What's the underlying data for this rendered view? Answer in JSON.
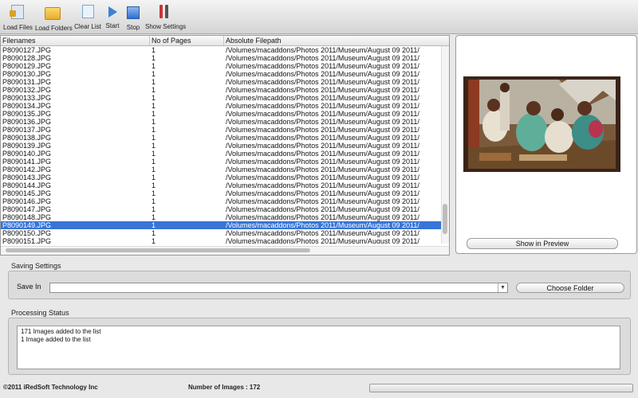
{
  "toolbar": {
    "load_files": "Load Files",
    "load_folders": "Load Folders",
    "clear_list": "Clear List",
    "start": "Start",
    "stop": "Stop",
    "show_settings": "Show Settings"
  },
  "table": {
    "columns": [
      "Filenames",
      "No of Pages",
      "Absolute Filepath"
    ],
    "selected_index": 22,
    "rows": [
      [
        "P8090127.JPG",
        "1",
        "/Volumes/macaddons/Photos 2011/Museum/August 09 2011/"
      ],
      [
        "P8090128.JPG",
        "1",
        "/Volumes/macaddons/Photos 2011/Museum/August 09 2011/"
      ],
      [
        "P8090129.JPG",
        "1",
        "/Volumes/macaddons/Photos 2011/Museum/August 09 2011/"
      ],
      [
        "P8090130.JPG",
        "1",
        "/Volumes/macaddons/Photos 2011/Museum/August 09 2011/"
      ],
      [
        "P8090131.JPG",
        "1",
        "/Volumes/macaddons/Photos 2011/Museum/August 09 2011/"
      ],
      [
        "P8090132.JPG",
        "1",
        "/Volumes/macaddons/Photos 2011/Museum/August 09 2011/"
      ],
      [
        "P8090133.JPG",
        "1",
        "/Volumes/macaddons/Photos 2011/Museum/August 09 2011/"
      ],
      [
        "P8090134.JPG",
        "1",
        "/Volumes/macaddons/Photos 2011/Museum/August 09 2011/"
      ],
      [
        "P8090135.JPG",
        "1",
        "/Volumes/macaddons/Photos 2011/Museum/August 09 2011/"
      ],
      [
        "P8090136.JPG",
        "1",
        "/Volumes/macaddons/Photos 2011/Museum/August 09 2011/"
      ],
      [
        "P8090137.JPG",
        "1",
        "/Volumes/macaddons/Photos 2011/Museum/August 09 2011/"
      ],
      [
        "P8090138.JPG",
        "1",
        "/Volumes/macaddons/Photos 2011/Museum/August 09 2011/"
      ],
      [
        "P8090139.JPG",
        "1",
        "/Volumes/macaddons/Photos 2011/Museum/August 09 2011/"
      ],
      [
        "P8090140.JPG",
        "1",
        "/Volumes/macaddons/Photos 2011/Museum/August 09 2011/"
      ],
      [
        "P8090141.JPG",
        "1",
        "/Volumes/macaddons/Photos 2011/Museum/August 09 2011/"
      ],
      [
        "P8090142.JPG",
        "1",
        "/Volumes/macaddons/Photos 2011/Museum/August 09 2011/"
      ],
      [
        "P8090143.JPG",
        "1",
        "/Volumes/macaddons/Photos 2011/Museum/August 09 2011/"
      ],
      [
        "P8090144.JPG",
        "1",
        "/Volumes/macaddons/Photos 2011/Museum/August 09 2011/"
      ],
      [
        "P8090145.JPG",
        "1",
        "/Volumes/macaddons/Photos 2011/Museum/August 09 2011/"
      ],
      [
        "P8090146.JPG",
        "1",
        "/Volumes/macaddons/Photos 2011/Museum/August 09 2011/"
      ],
      [
        "P8090147.JPG",
        "1",
        "/Volumes/macaddons/Photos 2011/Museum/August 09 2011/"
      ],
      [
        "P8090148.JPG",
        "1",
        "/Volumes/macaddons/Photos 2011/Museum/August 09 2011/"
      ],
      [
        "P8090149.JPG",
        "1",
        "/Volumes/macaddons/Photos 2011/Museum/August 09 2011/"
      ],
      [
        "P8090150.JPG",
        "1",
        "/Volumes/macaddons/Photos 2011/Museum/August 09 2011/"
      ],
      [
        "P8090151.JPG",
        "1",
        "/Volumes/macaddons/Photos 2011/Museum/August 09 2011/"
      ]
    ]
  },
  "preview": {
    "button_label": "Show in Preview"
  },
  "saving": {
    "group_title": "Saving Settings",
    "save_in_label": "Save In",
    "save_in_value": "",
    "choose_folder": "Choose Folder"
  },
  "processing": {
    "group_title": "Processing Status",
    "lines": [
      "171 Images added to the list",
      "1 Image added to the list"
    ]
  },
  "footer": {
    "copyright": "©2011 iRedSoft Technology Inc",
    "image_count": "Number of Images : 172",
    "progress": 0
  },
  "colors": {
    "selection": "#3875d7",
    "accent": "#3b82d4"
  }
}
